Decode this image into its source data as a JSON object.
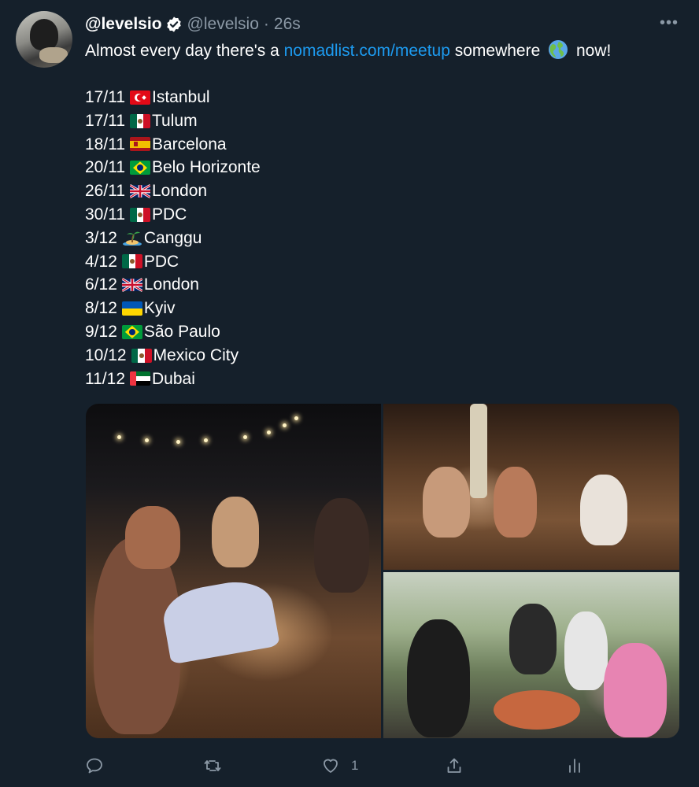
{
  "tweet": {
    "display_name": "@levelsio",
    "handle": "@levelsio",
    "separator": "·",
    "time": "26s",
    "text_before_link": "Almost every day there's a ",
    "link_text": "nomadlist.com/meetup",
    "text_after_link": " somewhere",
    "text_end": "now!",
    "globe_emoji": "globe-americas-icon",
    "more_label": "•••"
  },
  "meetups": [
    {
      "date": "17/11",
      "flag": "turkey",
      "city": "Istanbul"
    },
    {
      "date": "17/11",
      "flag": "mexico",
      "city": "Tulum"
    },
    {
      "date": "18/11",
      "flag": "spain",
      "city": "Barcelona"
    },
    {
      "date": "20/11",
      "flag": "brazil",
      "city": "Belo Horizonte"
    },
    {
      "date": "26/11",
      "flag": "uk",
      "city": "London"
    },
    {
      "date": "30/11",
      "flag": "mexico",
      "city": "PDC"
    },
    {
      "date": "3/12",
      "flag": "island",
      "city": "Canggu"
    },
    {
      "date": "4/12",
      "flag": "mexico",
      "city": "PDC"
    },
    {
      "date": "6/12",
      "flag": "uk",
      "city": "London"
    },
    {
      "date": "8/12",
      "flag": "ukraine",
      "city": "Kyiv"
    },
    {
      "date": "9/12",
      "flag": "brazil",
      "city": "São Paulo"
    },
    {
      "date": "10/12",
      "flag": "mexico",
      "city": "Mexico City"
    },
    {
      "date": "11/12",
      "flag": "uae",
      "city": "Dubai"
    }
  ],
  "actions": {
    "like_count": "1"
  },
  "colors": {
    "background": "#15202b",
    "text": "#ffffff",
    "muted": "#8b98a5",
    "link": "#1d9bf0"
  }
}
